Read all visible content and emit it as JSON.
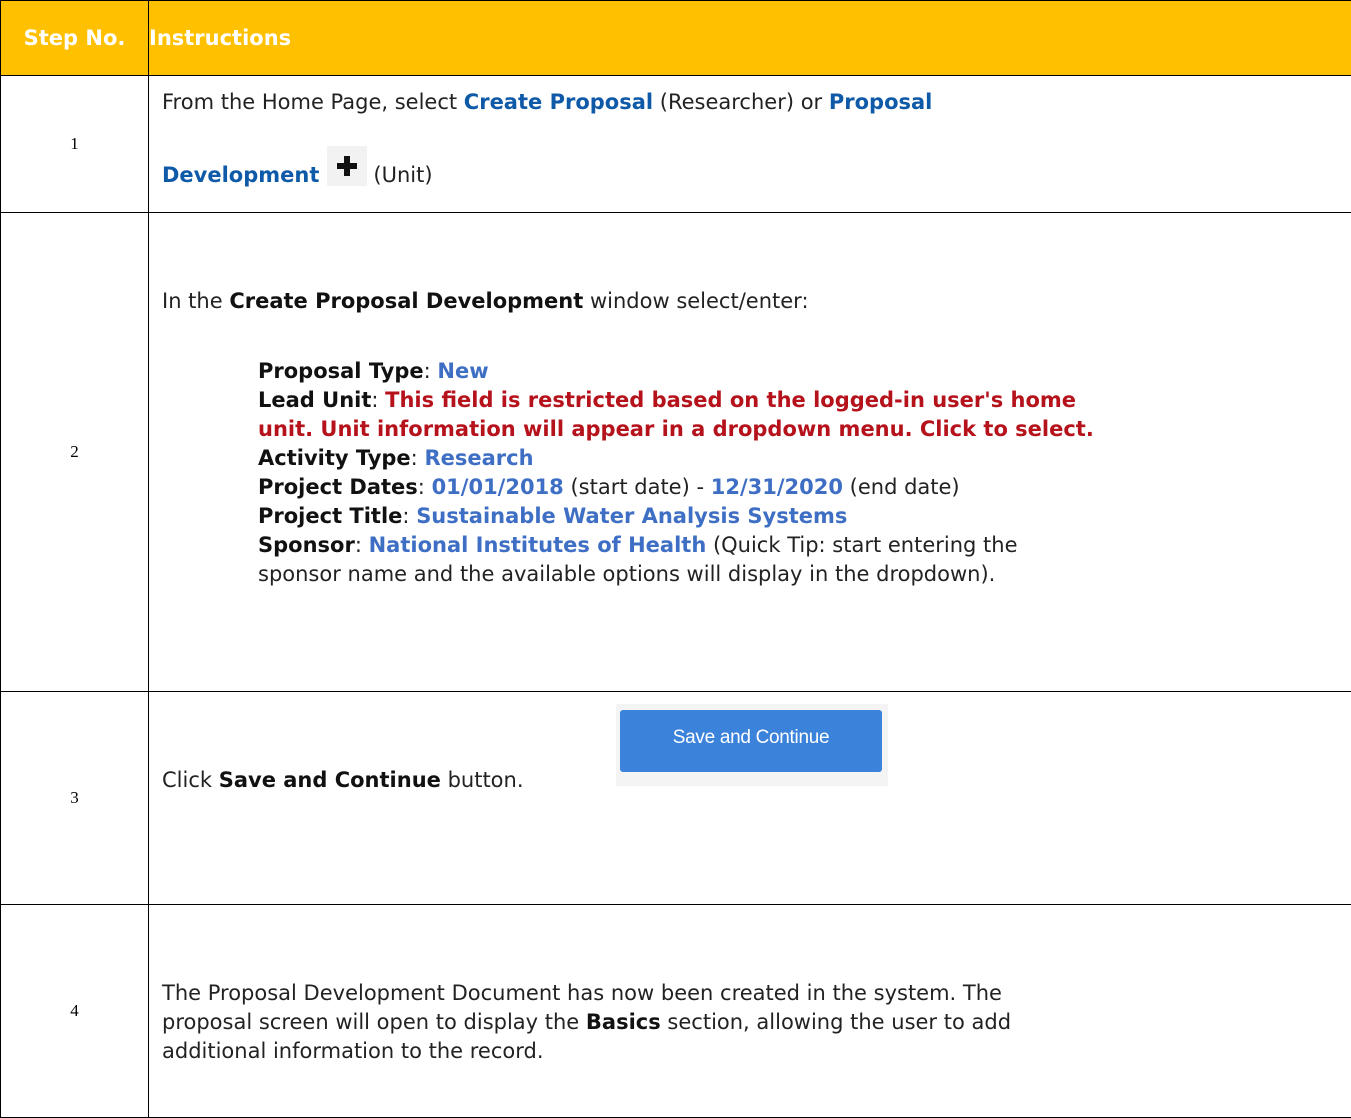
{
  "header": {
    "step_label": "Step No.",
    "instructions_label": "Instructions"
  },
  "colors": {
    "header_bg": "#ffc000",
    "link_blue": "#0f5aa8",
    "value_blue": "#3f6fc4",
    "warning_red": "#b5121b",
    "button_blue": "#3b82db"
  },
  "steps": [
    {
      "number": "1",
      "text_intro": "From the Home Page, select ",
      "link1": "Create Proposal",
      "text_mid": " (Researcher) or ",
      "link2_part1": "Proposal",
      "link2_part2": "Development",
      "icon": "plus-icon",
      "text_end": "(Unit)"
    },
    {
      "number": "2",
      "intro_pre": "In the ",
      "intro_bold": "Create Proposal Development",
      "intro_post": " window select/enter:",
      "fields": {
        "proposal_type_label": "Proposal Type",
        "proposal_type_value": "New",
        "lead_unit_label": "Lead Unit",
        "lead_unit_value_line1": "This field is restricted based on the logged-in user's home",
        "lead_unit_value_line2": "unit. Unit information will appear in a dropdown menu. Click to select.",
        "activity_type_label": "Activity Type",
        "activity_type_value": "Research",
        "project_dates_label": "Project Dates",
        "start_date": "01/01/2018",
        "start_note": " (start date) - ",
        "end_date": "12/31/2020",
        "end_note": " (end date)",
        "project_title_label": "Project Title",
        "project_title_value": "Sustainable Water Analysis Systems",
        "sponsor_label": "Sponsor",
        "sponsor_value": "National Institutes of Health",
        "sponsor_tip_line1": " (Quick Tip: start entering the",
        "sponsor_tip_line2": "sponsor name and the available options will display in the dropdown)."
      }
    },
    {
      "number": "3",
      "text_pre": "Click ",
      "text_bold": "Save and Continue",
      "text_post": " button.",
      "button_label": "Save and Continue"
    },
    {
      "number": "4",
      "line1": "The Proposal Development Document has now been created in the system.  The",
      "line2_pre": "proposal screen will open to display the ",
      "line2_bold": "Basics",
      "line2_post": " section, allowing the user to add",
      "line3": "additional information to the record."
    }
  ]
}
